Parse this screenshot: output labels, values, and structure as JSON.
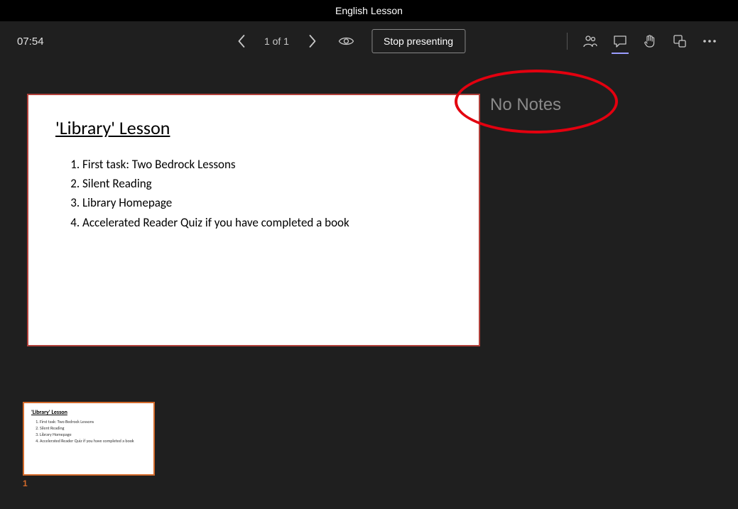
{
  "titlebar": {
    "title": "English Lesson"
  },
  "toolbar": {
    "timer": "07:54",
    "slide_counter": "1 of 1",
    "stop_label": "Stop presenting"
  },
  "slide": {
    "title": "'Library' Lesson",
    "items": [
      "First task: Two Bedrock Lessons",
      "Silent Reading",
      "Library Homepage",
      "Accelerated Reader Quiz if you have completed a book"
    ]
  },
  "notes": {
    "empty_label": "No Notes"
  },
  "thumbnail": {
    "title": "'Library' Lesson",
    "items": [
      "First task: Two Bedrock Lessons",
      "Silent Reading",
      "Library Homepage",
      "Accelerated Reader Quiz if you have completed a book"
    ],
    "number": "1"
  }
}
